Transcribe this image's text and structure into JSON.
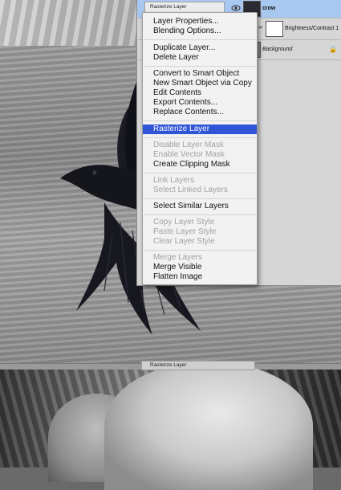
{
  "layers_panel": {
    "layers": [
      {
        "name": "crow",
        "selected": true
      },
      {
        "name": "Brightness/Contrast 1",
        "selected": false
      },
      {
        "name": "Background",
        "selected": false,
        "locked": true
      }
    ]
  },
  "tooltips": {
    "top": "Rasterize Layer",
    "bottom": "Rasterize Layer"
  },
  "context_menu": {
    "groups": [
      [
        {
          "label": "Layer Properties...",
          "enabled": true
        },
        {
          "label": "Blending Options...",
          "enabled": true
        }
      ],
      [
        {
          "label": "Duplicate Layer...",
          "enabled": true
        },
        {
          "label": "Delete Layer",
          "enabled": true
        }
      ],
      [
        {
          "label": "Convert to Smart Object",
          "enabled": true
        },
        {
          "label": "New Smart Object via Copy",
          "enabled": true
        },
        {
          "label": "Edit Contents",
          "enabled": true
        },
        {
          "label": "Export Contents...",
          "enabled": true
        },
        {
          "label": "Replace Contents...",
          "enabled": true
        }
      ],
      [
        {
          "label": "Rasterize Layer",
          "enabled": true,
          "highlighted": true
        }
      ],
      [
        {
          "label": "Disable Layer Mask",
          "enabled": false
        },
        {
          "label": "Enable Vector Mask",
          "enabled": false
        },
        {
          "label": "Create Clipping Mask",
          "enabled": true
        }
      ],
      [
        {
          "label": "Link Layers",
          "enabled": false
        },
        {
          "label": "Select Linked Layers",
          "enabled": false
        }
      ],
      [
        {
          "label": "Select Similar Layers",
          "enabled": true
        }
      ],
      [
        {
          "label": "Copy Layer Style",
          "enabled": false
        },
        {
          "label": "Paste Layer Style",
          "enabled": false
        },
        {
          "label": "Clear Layer Style",
          "enabled": false
        }
      ],
      [
        {
          "label": "Merge Layers",
          "enabled": false
        },
        {
          "label": "Merge Visible",
          "enabled": true
        },
        {
          "label": "Flatten Image",
          "enabled": true
        }
      ]
    ]
  },
  "colors": {
    "highlight": "#2f55d6",
    "selected_layer": "#a9c8f0",
    "disabled_text": "#a2a2a2"
  }
}
